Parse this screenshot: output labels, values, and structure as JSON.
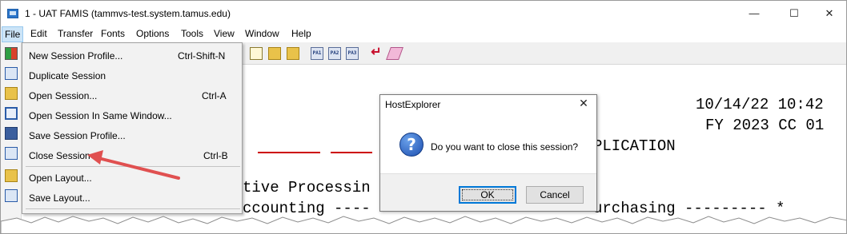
{
  "window": {
    "title": "1 - UAT FAMIS (tammvs-test.system.tamus.edu)",
    "minimize": "—",
    "maximize": "☐",
    "close": "✕"
  },
  "menubar": {
    "items": [
      "File",
      "Edit",
      "Transfer",
      "Fonts",
      "Options",
      "Tools",
      "View",
      "Window",
      "Help"
    ]
  },
  "file_menu": {
    "items": [
      {
        "label": "New Session Profile...",
        "shortcut": "Ctrl-Shift-N"
      },
      {
        "label": "Duplicate Session",
        "shortcut": ""
      },
      {
        "label": "Open Session...",
        "shortcut": "Ctrl-A"
      },
      {
        "label": "Open Session In Same Window...",
        "shortcut": ""
      },
      {
        "label": "Save Session Profile...",
        "shortcut": ""
      },
      {
        "label": "Close Session",
        "shortcut": "Ctrl-B"
      },
      {
        "label": "Open Layout...",
        "shortcut": ""
      },
      {
        "label": "Save Layout...",
        "shortcut": ""
      }
    ]
  },
  "toolbar": {
    "pf_keys": [
      "PA1",
      "PA2",
      "PA3"
    ]
  },
  "terminal": {
    "datetime": "10/14/22 10:42",
    "fiscal": "FY 2023 CC 01",
    "line_application": "PLICATION",
    "line_processing": "tive Processin",
    "line_accounting": "ccounting ----",
    "line_purchasing": "urchasing --------- *"
  },
  "dialog": {
    "title": "HostExplorer",
    "close_glyph": "✕",
    "icon_glyph": "?",
    "message": "Do you want to close this session?",
    "ok_label": "OK",
    "cancel_label": "Cancel"
  },
  "colors": {
    "annotation_arrow": "#e05050",
    "menu_highlight": "#cce4f7",
    "terminal_rule": "#cc0000",
    "dialog_default_border": "#0078d7"
  }
}
